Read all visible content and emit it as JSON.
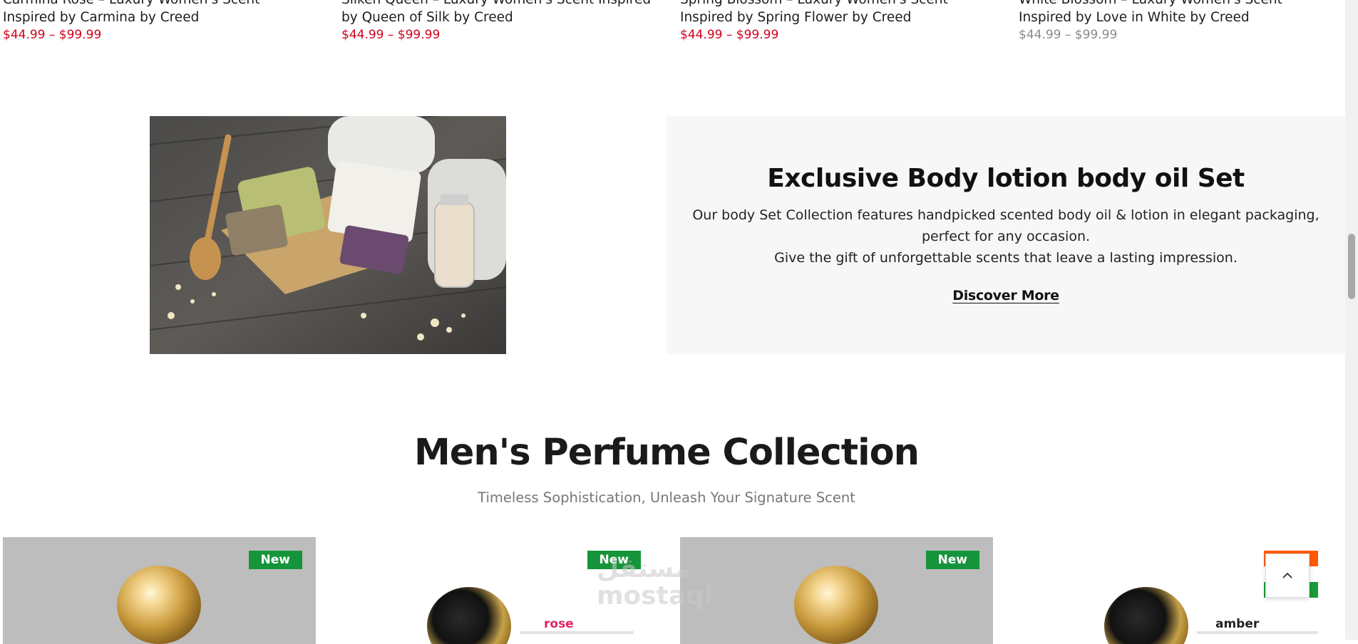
{
  "top_products": [
    {
      "name": "Carmina Rose – Luxury Women's Scent Inspired by Carmina by Creed",
      "price": "$44.99 – $99.99",
      "on_sale": true
    },
    {
      "name": "Silken Queen – Luxury Women's Scent Inspired by Queen of Silk by Creed",
      "price": "$44.99 – $99.99",
      "on_sale": true
    },
    {
      "name": "Spring Blossom – Luxury Women's Scent Inspired by Spring Flower by Creed",
      "price": "$44.99 – $99.99",
      "on_sale": true
    },
    {
      "name": "White Blossom – Luxury Women's Scent Inspired by Love in White by Creed",
      "price": "$44.99 – $99.99",
      "on_sale": false
    }
  ],
  "promo": {
    "title": "Exclusive Body lotion body oil Set",
    "line1": "Our body Set Collection features handpicked scented body oil & lotion in elegant packaging, perfect for any occasion.",
    "line2": "Give the gift of unforgettable scents that leave a lasting impression.",
    "cta": "Discover More"
  },
  "section": {
    "title": "Men's Perfume Collection",
    "subtitle": "Timeless Sophistication, Unleash Your Signature Scent"
  },
  "cards": [
    {
      "badge": "New",
      "label": ""
    },
    {
      "badge": "New",
      "label": "rose"
    },
    {
      "badge": "New",
      "label": ""
    },
    {
      "badge": "",
      "label": "amber"
    }
  ],
  "colors": {
    "price_sale": "#d0021b",
    "price_regular": "#8a8a8a",
    "badge": "#16943b",
    "promo_bg": "#f7f7f7"
  },
  "icons": {
    "back_to_top": "chevron-up-icon"
  }
}
